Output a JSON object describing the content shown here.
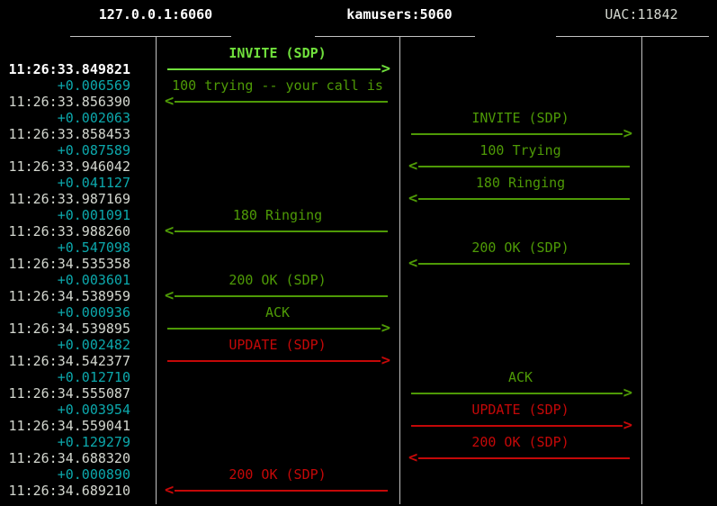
{
  "colors": {
    "background": "#000000",
    "bright_green": "#70e03c",
    "green": "#4e9a06",
    "red": "#c40808",
    "cyan": "#0ca8ac",
    "white": "#d3d7cf",
    "bold_white": "#ffffff",
    "line": "#c2c2c2"
  },
  "glyphs": {
    "right": ">",
    "left": "<"
  },
  "endpoints": [
    {
      "label": "127.0.0.1:6060",
      "emphasis": "bold"
    },
    {
      "label": "kamusers:5060",
      "emphasis": "bold"
    },
    {
      "label": "UAC:11842",
      "emphasis": "normal"
    }
  ],
  "messages": [
    {
      "time": "11:26:33.849821",
      "delta": "",
      "label": "INVITE (SDP)",
      "lane": "left",
      "direction": "right",
      "color": "bright",
      "selected": true
    },
    {
      "time": "11:26:33.856390",
      "delta": "+0.006569",
      "label": "100 trying -- your call is",
      "lane": "left",
      "direction": "left",
      "color": "green"
    },
    {
      "time": "11:26:33.858453",
      "delta": "+0.002063",
      "label": "INVITE (SDP)",
      "lane": "right",
      "direction": "right",
      "color": "green"
    },
    {
      "time": "11:26:33.946042",
      "delta": "+0.087589",
      "label": "100 Trying",
      "lane": "right",
      "direction": "left",
      "color": "green"
    },
    {
      "time": "11:26:33.987169",
      "delta": "+0.041127",
      "label": "180 Ringing",
      "lane": "right",
      "direction": "left",
      "color": "green"
    },
    {
      "time": "11:26:33.988260",
      "delta": "+0.001091",
      "label": "180 Ringing",
      "lane": "left",
      "direction": "left",
      "color": "green"
    },
    {
      "time": "11:26:34.535358",
      "delta": "+0.547098",
      "label": "200 OK (SDP)",
      "lane": "right",
      "direction": "left",
      "color": "green"
    },
    {
      "time": "11:26:34.538959",
      "delta": "+0.003601",
      "label": "200 OK (SDP)",
      "lane": "left",
      "direction": "left",
      "color": "green"
    },
    {
      "time": "11:26:34.539895",
      "delta": "+0.000936",
      "label": "ACK",
      "lane": "left",
      "direction": "right",
      "color": "green"
    },
    {
      "time": "11:26:34.542377",
      "delta": "+0.002482",
      "label": "UPDATE (SDP)",
      "lane": "left",
      "direction": "right",
      "color": "red"
    },
    {
      "time": "11:26:34.555087",
      "delta": "+0.012710",
      "label": "ACK",
      "lane": "right",
      "direction": "right",
      "color": "green"
    },
    {
      "time": "11:26:34.559041",
      "delta": "+0.003954",
      "label": "UPDATE (SDP)",
      "lane": "right",
      "direction": "right",
      "color": "red"
    },
    {
      "time": "11:26:34.688320",
      "delta": "+0.129279",
      "label": "200 OK (SDP)",
      "lane": "right",
      "direction": "left",
      "color": "red"
    },
    {
      "time": "11:26:34.689210",
      "delta": "+0.000890",
      "label": "200 OK (SDP)",
      "lane": "left",
      "direction": "left",
      "color": "red"
    }
  ]
}
